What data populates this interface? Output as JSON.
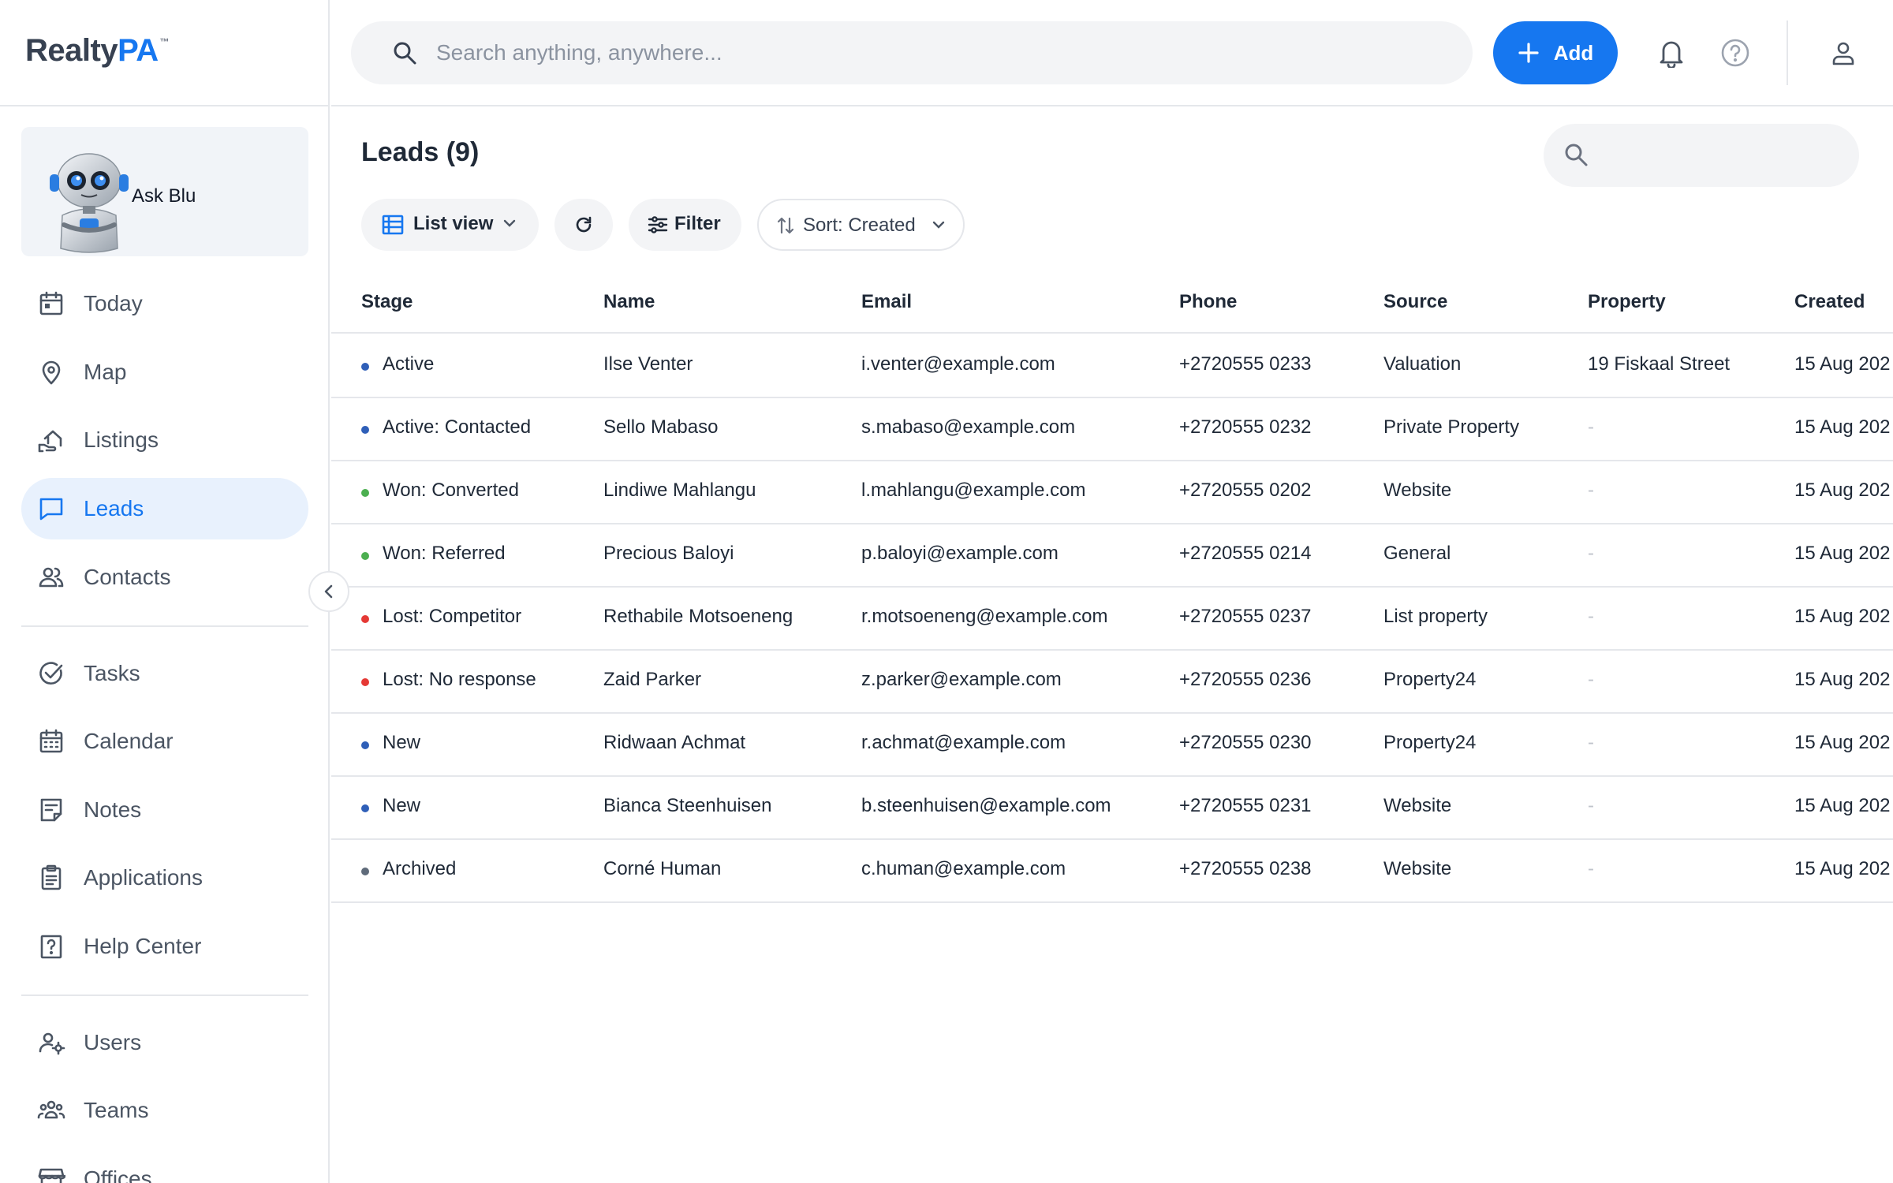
{
  "app": {
    "logo_main": "Realty",
    "logo_accent": "PA",
    "logo_tm": "™"
  },
  "sidebar": {
    "ask_blu_label": "Ask Blu",
    "items": [
      {
        "label": "Today",
        "icon": "calendar-day-icon"
      },
      {
        "label": "Map",
        "icon": "map-pin-icon"
      },
      {
        "label": "Listings",
        "icon": "listings-hand-icon"
      },
      {
        "label": "Leads",
        "icon": "chat-bubble-icon",
        "active": true
      },
      {
        "label": "Contacts",
        "icon": "users-icon"
      },
      {
        "label": "Tasks",
        "icon": "check-circle-icon"
      },
      {
        "label": "Calendar",
        "icon": "calendar-icon"
      },
      {
        "label": "Notes",
        "icon": "note-icon"
      },
      {
        "label": "Applications",
        "icon": "clipboard-icon"
      },
      {
        "label": "Help Center",
        "icon": "help-square-icon"
      },
      {
        "label": "Users",
        "icon": "user-gear-icon"
      },
      {
        "label": "Teams",
        "icon": "team-icon"
      },
      {
        "label": "Offices",
        "icon": "store-icon"
      }
    ]
  },
  "topbar": {
    "search_placeholder": "Search anything, anywhere...",
    "add_label": "Add"
  },
  "main": {
    "title": "Leads (9)",
    "toolbar": {
      "list_view_label": "List view",
      "filter_label": "Filter",
      "sort_label": "Sort: Created"
    },
    "columns": [
      "Stage",
      "Name",
      "Email",
      "Phone",
      "Source",
      "Property",
      "Created"
    ],
    "rows": [
      {
        "stage": "Active",
        "stage_color": "#2f5fb8",
        "name": "Ilse Venter",
        "email": "i.venter@example.com",
        "phone": "+2720555 0233",
        "source": "Valuation",
        "property": "19 Fiskaal Street",
        "created": "15 Aug 202"
      },
      {
        "stage": "Active: Contacted",
        "stage_color": "#2f5fb8",
        "name": "Sello Mabaso",
        "email": "s.mabaso@example.com",
        "phone": "+2720555 0232",
        "source": "Private Property",
        "property": "-",
        "created": "15 Aug 202"
      },
      {
        "stage": "Won: Converted",
        "stage_color": "#4caf50",
        "name": "Lindiwe Mahlangu",
        "email": "l.mahlangu@example.com",
        "phone": "+2720555 0202",
        "source": "Website",
        "property": "-",
        "created": "15 Aug 202"
      },
      {
        "stage": "Won: Referred",
        "stage_color": "#4caf50",
        "name": "Precious Baloyi",
        "email": "p.baloyi@example.com",
        "phone": "+2720555 0214",
        "source": "General",
        "property": "-",
        "created": "15 Aug 202"
      },
      {
        "stage": "Lost: Competitor",
        "stage_color": "#e53935",
        "name": "Rethabile Motsoeneng",
        "email": "r.motsoeneng@example.com",
        "phone": "+2720555 0237",
        "source": "List property",
        "property": "-",
        "created": "15 Aug 202"
      },
      {
        "stage": "Lost: No response",
        "stage_color": "#e53935",
        "name": "Zaid Parker",
        "email": "z.parker@example.com",
        "phone": "+2720555 0236",
        "source": "Property24",
        "property": "-",
        "created": "15 Aug 202"
      },
      {
        "stage": "New",
        "stage_color": "#2f5fb8",
        "name": "Ridwaan Achmat",
        "email": "r.achmat@example.com",
        "phone": "+2720555 0230",
        "source": "Property24",
        "property": "-",
        "created": "15 Aug 202"
      },
      {
        "stage": "New",
        "stage_color": "#2f5fb8",
        "name": "Bianca Steenhuisen",
        "email": "b.steenhuisen@example.com",
        "phone": "+2720555 0231",
        "source": "Website",
        "property": "-",
        "created": "15 Aug 202"
      },
      {
        "stage": "Archived",
        "stage_color": "#5f6b7a",
        "name": "Corné Human",
        "email": "c.human@example.com",
        "phone": "+2720555 0238",
        "source": "Website",
        "property": "-",
        "created": "15 Aug 202"
      }
    ]
  },
  "colors": {
    "accent": "#1677f0",
    "active_nav_bg": "#e8f1fd",
    "surface": "#f3f4f6",
    "border": "#e5e7eb"
  }
}
